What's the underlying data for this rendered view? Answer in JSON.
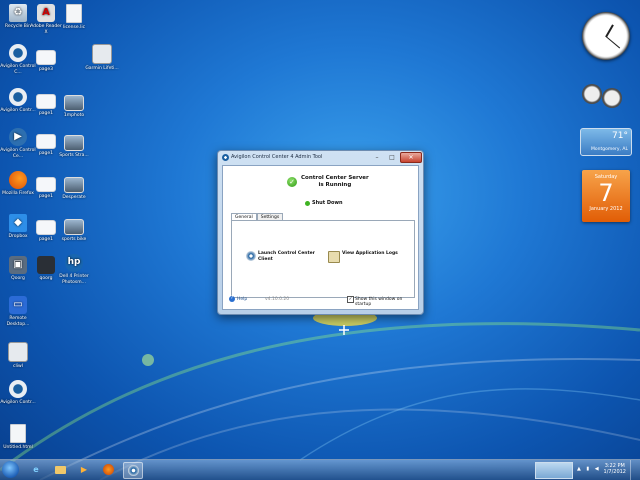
{
  "desktop": {
    "icons": [
      {
        "label": "Recycle Bin",
        "icon": "recycle-bin-icon"
      },
      {
        "label": "Adobe Reader X",
        "icon": "pdf-icon"
      },
      {
        "label": "license.lic",
        "icon": "file-icon"
      },
      {
        "label": "Avigilon Control C...",
        "icon": "avigilon-icon"
      },
      {
        "label": "page3",
        "icon": "folder-icon"
      },
      {
        "label": "Garmin Lifeti...",
        "icon": "installer-icon"
      },
      {
        "label": "Avigilon Contr...",
        "icon": "avigilon-icon"
      },
      {
        "label": "page1",
        "icon": "folder-icon"
      },
      {
        "label": "1mphoto",
        "icon": "photo-icon"
      },
      {
        "label": "Avigilon Control Ce...",
        "icon": "player-icon"
      },
      {
        "label": "page1",
        "icon": "folder-icon"
      },
      {
        "label": "Sports Stra...",
        "icon": "photo-icon"
      },
      {
        "label": "Mozilla Firefox",
        "icon": "firefox-icon"
      },
      {
        "label": "page1",
        "icon": "folder-icon"
      },
      {
        "label": "Desperate",
        "icon": "photo-icon"
      },
      {
        "label": "Dropbox",
        "icon": "dropbox-icon"
      },
      {
        "label": "page1",
        "icon": "folder-icon"
      },
      {
        "label": "sports bike",
        "icon": "photo-icon"
      },
      {
        "label": "Qoorg",
        "icon": "app-icon"
      },
      {
        "label": "qoorg",
        "icon": "dark-icon"
      },
      {
        "label": "Dell 4 Printer Photosm...",
        "icon": "hp-icon"
      },
      {
        "label": "Remote Desktop...",
        "icon": "remote-desktop-icon"
      },
      {
        "label": "cliwl",
        "icon": "scanner-icon"
      },
      {
        "label": "Avigilon Contr...",
        "icon": "avigilon-icon"
      },
      {
        "label": "Untitled.html",
        "icon": "file-icon"
      }
    ]
  },
  "gadgets": {
    "weather": {
      "temp": "71°",
      "location": "Montgomery, AL"
    },
    "calendar": {
      "weekday": "Saturday",
      "day": "7",
      "month_year": "January 2012"
    }
  },
  "window": {
    "title": "Avigilon Control Center 4 Admin Tool",
    "status_line1": "Control Center Server",
    "status_line2": "is Running",
    "shutdown_label": "Shut Down",
    "tabs": [
      {
        "label": "General"
      },
      {
        "label": "Settings"
      }
    ],
    "actions": {
      "launch_line1": "Launch Control Center",
      "launch_line2": "Client",
      "logs": "View Application Logs"
    },
    "footer": {
      "help": "Help",
      "version": "v4.10.0.20",
      "startup_checkbox_label": "Show this window on startup"
    }
  },
  "taskbar": {
    "time": "3:22 PM",
    "date": "1/7/2012"
  }
}
